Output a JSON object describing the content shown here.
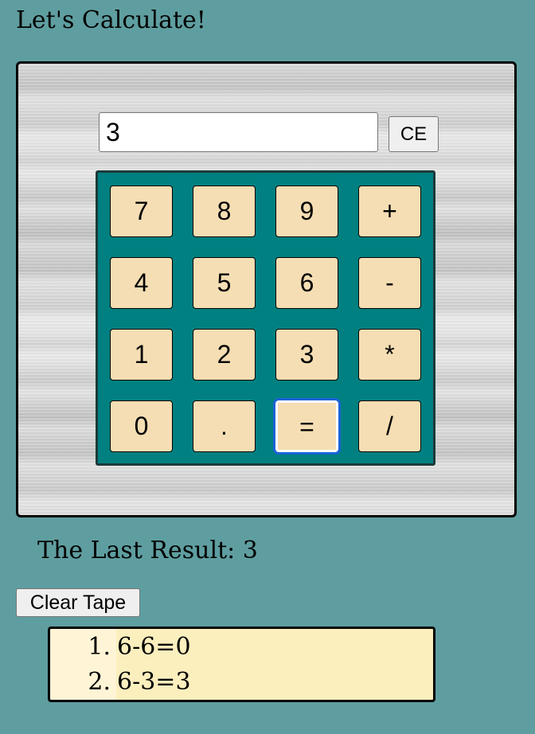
{
  "page": {
    "title": "Let's Calculate!"
  },
  "calculator": {
    "display_value": "3",
    "ce_label": "CE",
    "keys": [
      [
        "7",
        "8",
        "9",
        "+"
      ],
      [
        "4",
        "5",
        "6",
        "-"
      ],
      [
        "1",
        "2",
        "3",
        "*"
      ],
      [
        "0",
        ".",
        "=",
        "/"
      ]
    ],
    "focused_key": "="
  },
  "last_result": {
    "text": "The Last Result: 3"
  },
  "tape": {
    "clear_label": "Clear Tape",
    "entries": [
      {
        "num": "1.",
        "text": "6-6=0"
      },
      {
        "num": "2.",
        "text": "6-3=3"
      }
    ]
  },
  "colors": {
    "page_background": "#5f9ea0",
    "keypad_background": "#008080",
    "key_background": "#f5deb3",
    "tape_background": "#fcefbe",
    "focus_ring": "#1a63d6"
  }
}
